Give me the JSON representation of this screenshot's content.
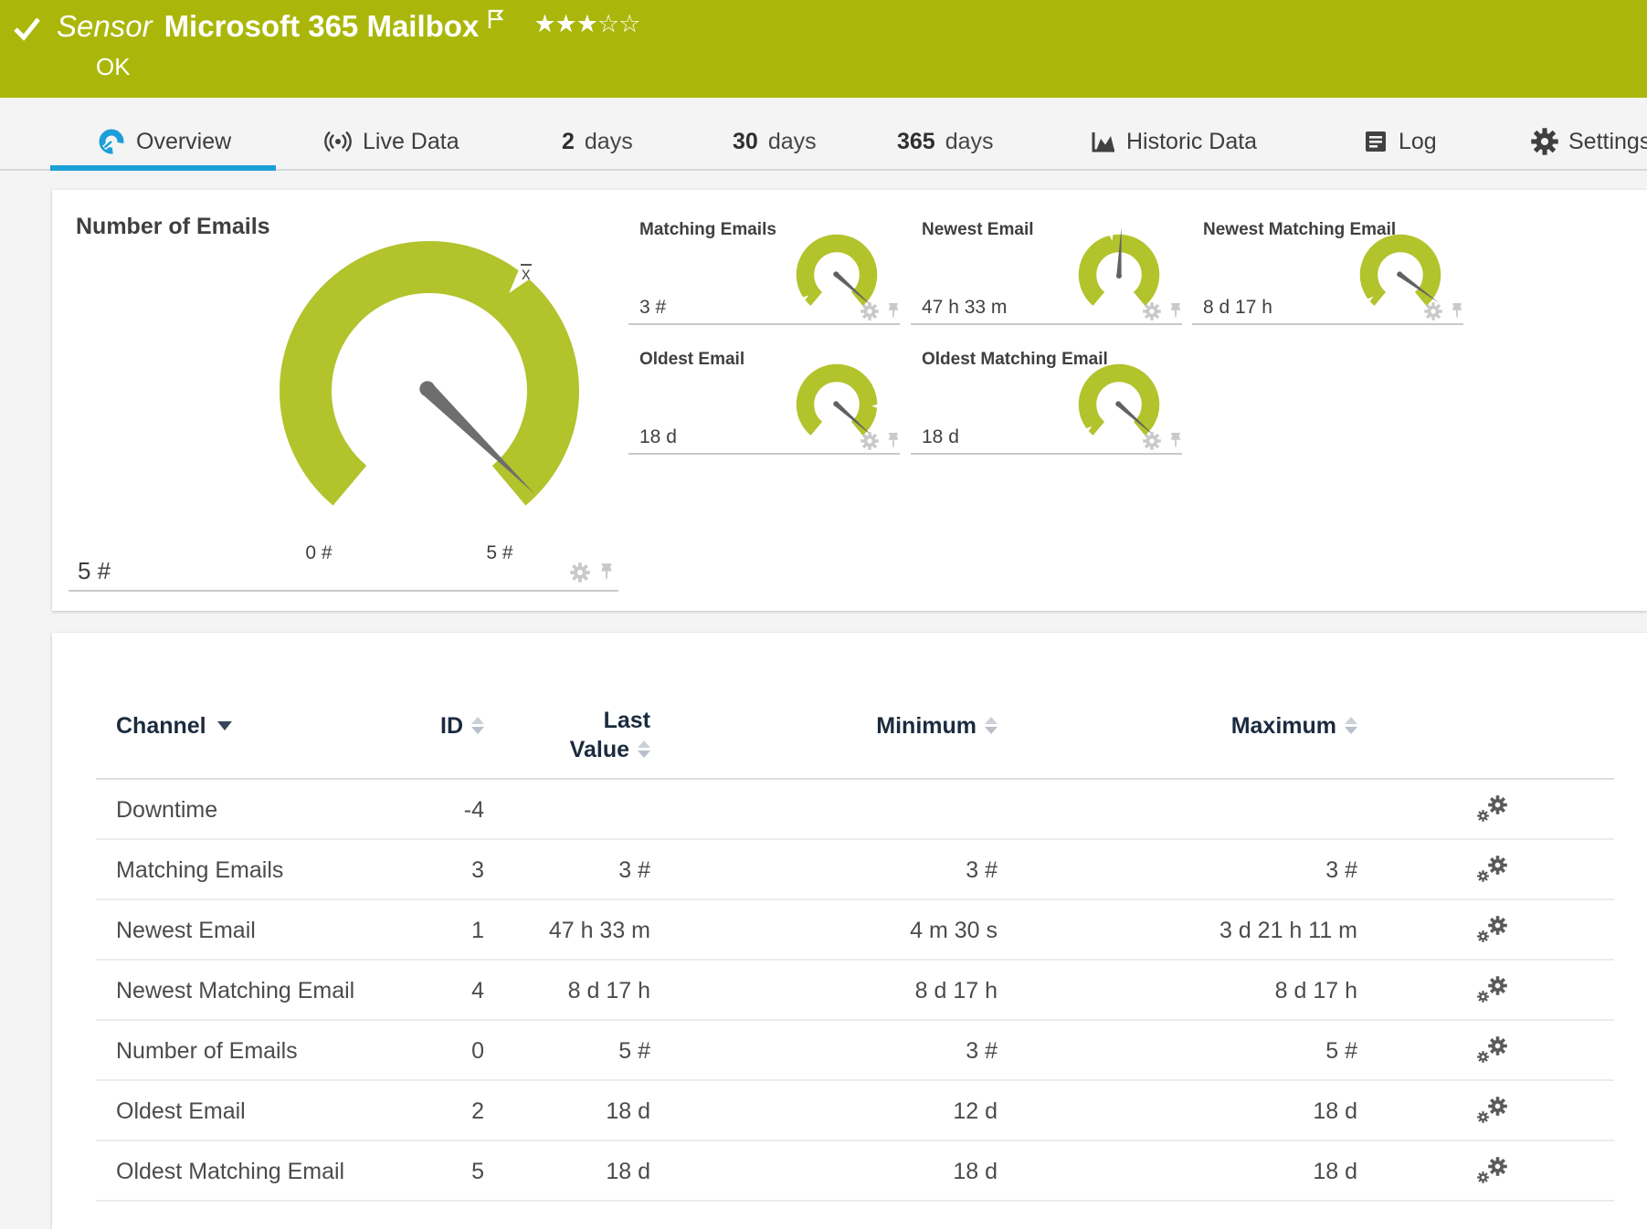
{
  "colors": {
    "header_green": "#aab70a",
    "gauge_green": "#b2c32c",
    "accent_blue": "#1d9fd8"
  },
  "header": {
    "kind": "Sensor",
    "title": "Microsoft 365 Mailbox",
    "status": "OK",
    "rating": {
      "filled_count": 3,
      "total": 5,
      "filled_glyphs": "★★★",
      "empty_glyphs": "☆☆"
    }
  },
  "tabs": [
    {
      "label": "Overview",
      "active": true
    },
    {
      "label": "Live Data"
    },
    {
      "num": "2",
      "label": "days"
    },
    {
      "num": "30",
      "label": "days"
    },
    {
      "num": "365",
      "label": "days"
    },
    {
      "label": "Historic Data"
    },
    {
      "label": "Log"
    },
    {
      "label": "Settings"
    }
  ],
  "chart_data": {
    "type": "gauge-set",
    "gauges": [
      {
        "name": "Number of Emails",
        "value_label": "5 #",
        "value": 5,
        "min": 0,
        "max": 5,
        "min_label": "0 #",
        "max_label": "5 #",
        "needle_fraction": 0.98,
        "avg_marker_fraction": 0.64,
        "size": "large"
      },
      {
        "name": "Matching Emails",
        "value_label": "3 #",
        "needle_fraction": 0.97,
        "avg_marker_fraction": 0.05,
        "size": "small"
      },
      {
        "name": "Newest Email",
        "value_label": "47 h 33 m",
        "needle_fraction": 0.51,
        "avg_marker_fraction": 0.46,
        "size": "small"
      },
      {
        "name": "Newest Matching Email",
        "value_label": "8 d 17 h",
        "needle_fraction": 0.95,
        "avg_marker_fraction": 0.04,
        "size": "small"
      },
      {
        "name": "Oldest Email",
        "value_label": "18 d",
        "needle_fraction": 0.97,
        "avg_marker_fraction": 0.83,
        "size": "small"
      },
      {
        "name": "Oldest Matching Email",
        "value_label": "18 d",
        "needle_fraction": 0.97,
        "avg_marker_fraction": 0.04,
        "size": "small"
      }
    ]
  },
  "table": {
    "columns": [
      "Channel",
      "ID",
      "Last Value",
      "Minimum",
      "Maximum"
    ],
    "last_value_lines": [
      "Last",
      "Value"
    ],
    "rows": [
      {
        "channel": "Downtime",
        "id": "-4",
        "last": "",
        "min": "",
        "max": ""
      },
      {
        "channel": "Matching Emails",
        "id": "3",
        "last": "3 #",
        "min": "3 #",
        "max": "3 #"
      },
      {
        "channel": "Newest Email",
        "id": "1",
        "last": "47 h 33 m",
        "min": "4 m 30 s",
        "max": "3 d 21 h 11 m"
      },
      {
        "channel": "Newest Matching Email",
        "id": "4",
        "last": "8 d 17 h",
        "min": "8 d 17 h",
        "max": "8 d 17 h"
      },
      {
        "channel": "Number of Emails",
        "id": "0",
        "last": "5 #",
        "min": "3 #",
        "max": "5 #"
      },
      {
        "channel": "Oldest Email",
        "id": "2",
        "last": "18 d",
        "min": "12 d",
        "max": "18 d"
      },
      {
        "channel": "Oldest Matching Email",
        "id": "5",
        "last": "18 d",
        "min": "18 d",
        "max": "18 d"
      }
    ]
  }
}
